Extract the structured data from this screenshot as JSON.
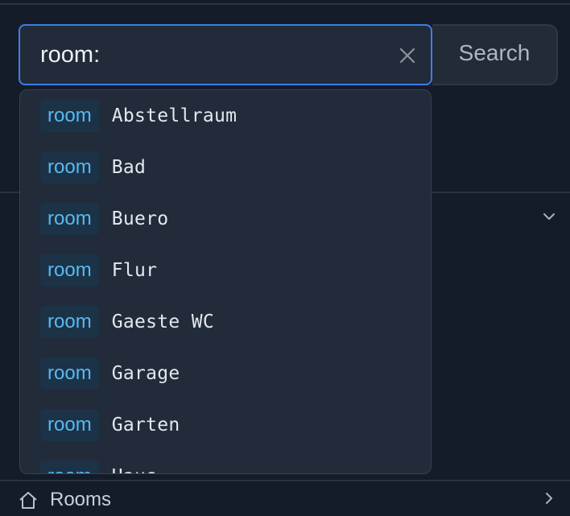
{
  "search": {
    "value": "room:",
    "button_label": "Search"
  },
  "suggestions": [
    {
      "tag": "room",
      "value": "Abstellraum"
    },
    {
      "tag": "room",
      "value": "Bad"
    },
    {
      "tag": "room",
      "value": "Buero"
    },
    {
      "tag": "room",
      "value": "Flur"
    },
    {
      "tag": "room",
      "value": "Gaeste WC"
    },
    {
      "tag": "room",
      "value": "Garage"
    },
    {
      "tag": "room",
      "value": "Garten"
    },
    {
      "tag": "room",
      "value": "Haus"
    }
  ],
  "sections": {
    "bottom_label": "Rooms"
  },
  "icons": {
    "clear": "close-icon",
    "section_toggle": "chevron-down-icon",
    "bottom_section": "home-icon",
    "bottom_toggle": "chevron-right-icon"
  },
  "colors": {
    "background": "#141b29",
    "focus_border": "#3c7ee8",
    "tag_text": "#57b9f3",
    "tag_background": "#1c3246"
  }
}
